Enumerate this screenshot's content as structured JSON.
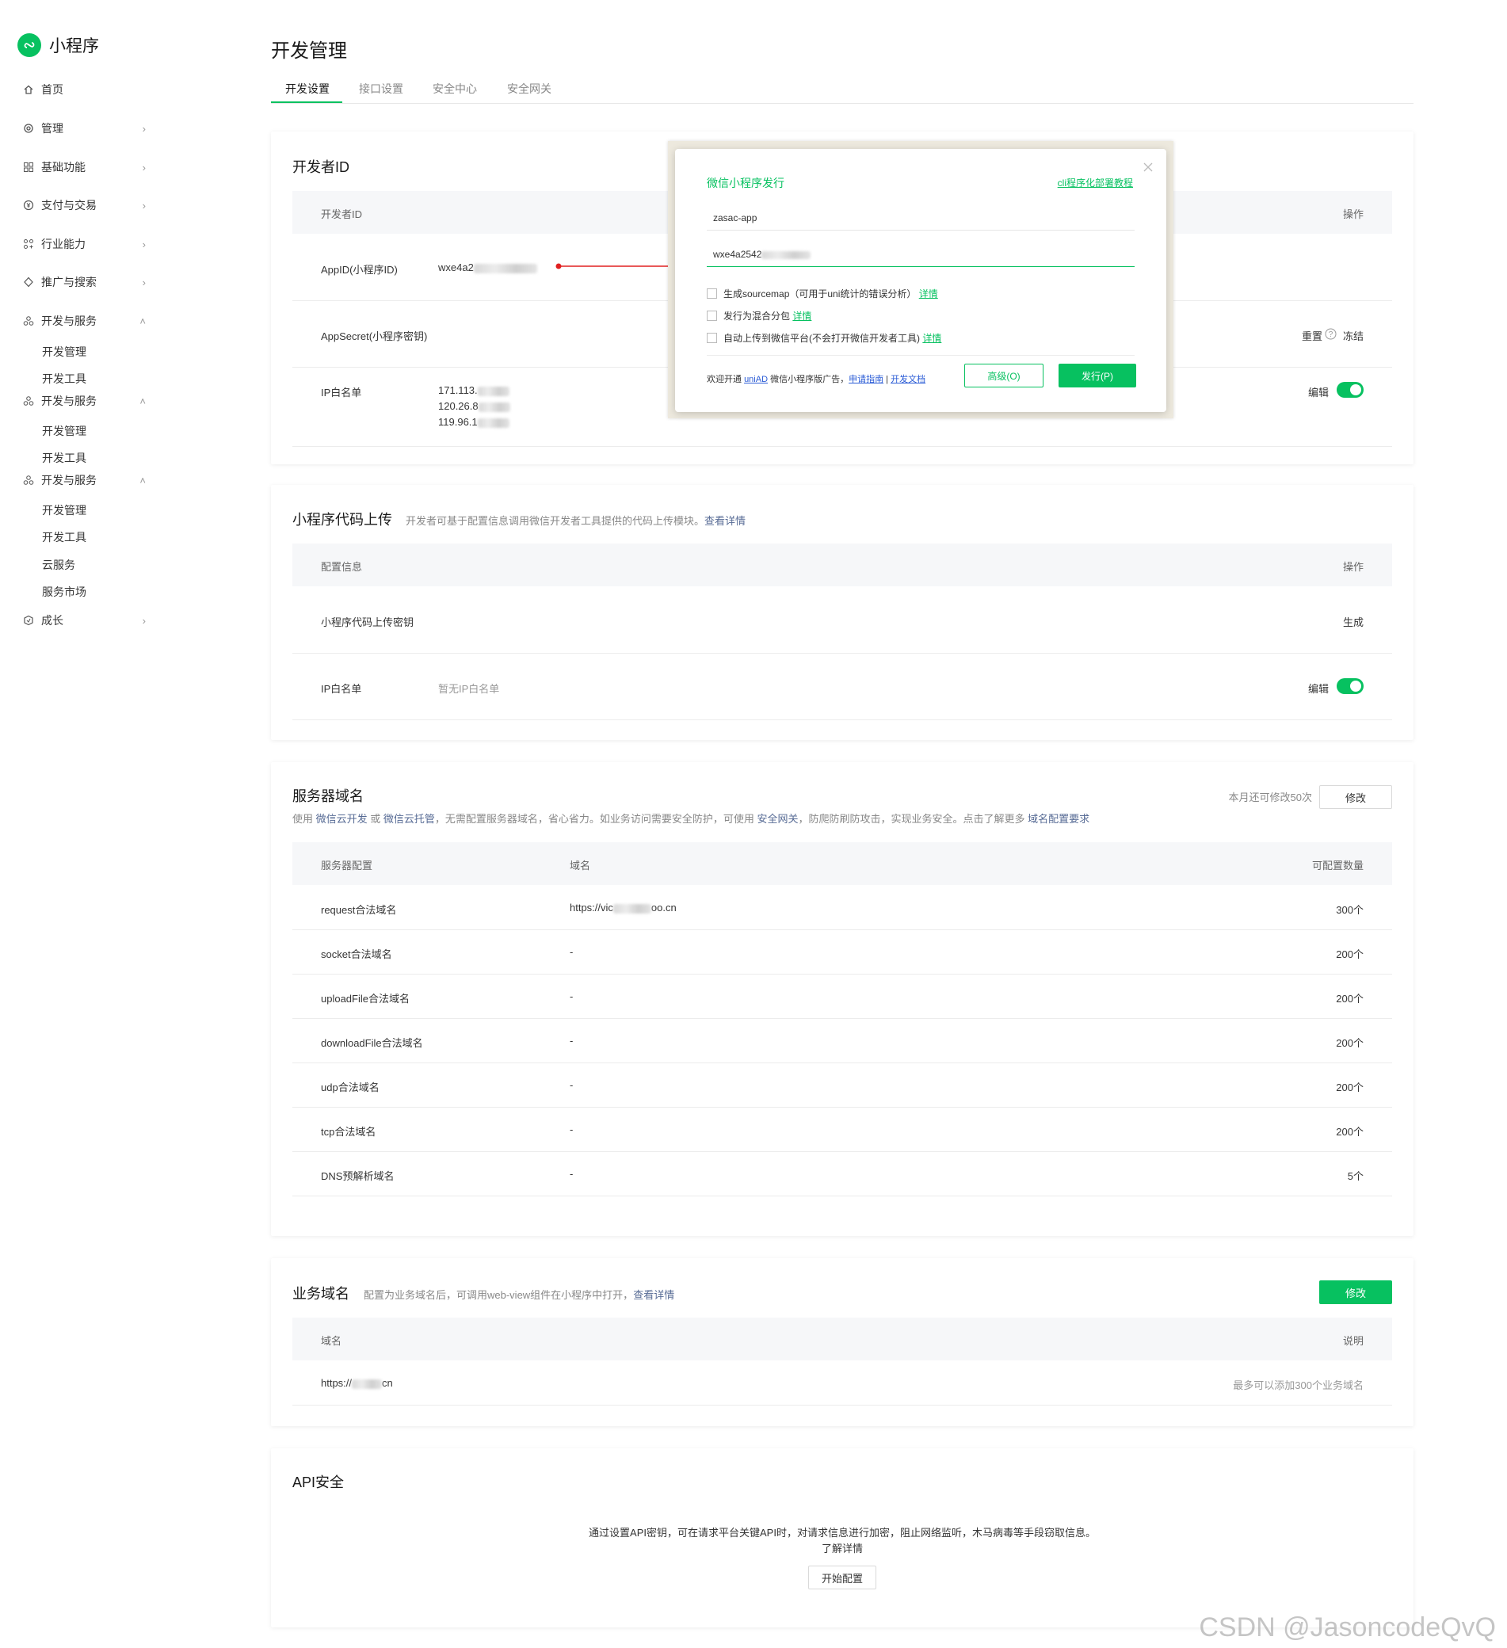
{
  "app": {
    "name": "小程序"
  },
  "sidebar": {
    "items": [
      {
        "label": "首页",
        "icon": "home-icon",
        "chevron": ""
      },
      {
        "label": "管理",
        "icon": "gear-icon",
        "chevron": "›"
      },
      {
        "label": "基础功能",
        "icon": "grid-icon",
        "chevron": "›"
      },
      {
        "label": "支付与交易",
        "icon": "yuan-icon",
        "chevron": "›"
      },
      {
        "label": "行业能力",
        "icon": "nodes-icon",
        "chevron": "›"
      },
      {
        "label": "推广与搜索",
        "icon": "tag-icon",
        "chevron": "›"
      },
      {
        "label": "开发与服务",
        "icon": "code-icon",
        "chevron": "˄"
      },
      {
        "label": "开发与服务",
        "icon": "code-icon",
        "chevron": "˄"
      },
      {
        "label": "开发与服务",
        "icon": "code-icon",
        "chevron": "˄"
      },
      {
        "label": "成长",
        "icon": "growth-icon",
        "chevron": "›"
      }
    ],
    "sub_a": [
      "开发管理",
      "开发工具"
    ],
    "sub_b": [
      "开发管理",
      "开发工具"
    ],
    "sub_c": [
      "开发管理",
      "开发工具",
      "云服务",
      "服务市场"
    ]
  },
  "header": {
    "title": "开发管理",
    "tabs": [
      "开发设置",
      "接口设置",
      "安全中心",
      "安全网关"
    ]
  },
  "developer_id": {
    "title": "开发者ID",
    "col_id": "开发者ID",
    "col_op": "操作",
    "appid_label": "AppID(小程序ID)",
    "appid_value": "wxe4a2",
    "secret_label": "AppSecret(小程序密钥)",
    "reset": "重置",
    "freeze": "冻结",
    "ip_label": "IP白名单",
    "ips": [
      "171.113.",
      "120.26.8",
      "119.96.1"
    ],
    "edit": "编辑"
  },
  "upload": {
    "title": "小程序代码上传",
    "desc": "开发者可基于配置信息调用微信开发者工具提供的代码上传模块。",
    "desc_link": "查看详情",
    "col_cfg": "配置信息",
    "col_op": "操作",
    "key_label": "小程序代码上传密钥",
    "generate": "生成",
    "ip_label": "IP白名单",
    "ip_value": "暂无IP白名单",
    "edit": "编辑"
  },
  "server_domain": {
    "title": "服务器域名",
    "quota_text": "本月还可修改50次",
    "modify": "修改",
    "desc_parts": [
      "使用 ",
      "微信云开发",
      " 或 ",
      "微信云托管",
      "，无需配置服务器域名，省心省力。如业务访问需要安全防护，可使用 ",
      "安全网关",
      "，防爬防刷防攻击，实现业务安全。点击了解更多 ",
      "域名配置要求"
    ],
    "columns": [
      "服务器配置",
      "域名",
      "可配置数量"
    ],
    "rows": [
      {
        "name": "request合法域名",
        "domain_prefix": "https://vic",
        "domain_suffix": "oo.cn",
        "count": "300个"
      },
      {
        "name": "socket合法域名",
        "domain_prefix": "-",
        "domain_suffix": "",
        "count": "200个"
      },
      {
        "name": "uploadFile合法域名",
        "domain_prefix": "-",
        "domain_suffix": "",
        "count": "200个"
      },
      {
        "name": "downloadFile合法域名",
        "domain_prefix": "-",
        "domain_suffix": "",
        "count": "200个"
      },
      {
        "name": "udp合法域名",
        "domain_prefix": "-",
        "domain_suffix": "",
        "count": "200个"
      },
      {
        "name": "tcp合法域名",
        "domain_prefix": "-",
        "domain_suffix": "",
        "count": "200个"
      },
      {
        "name": "DNS预解析域名",
        "domain_prefix": "-",
        "domain_suffix": "",
        "count": "5个"
      }
    ]
  },
  "biz_domain": {
    "title": "业务域名",
    "desc": "配置为业务域名后，可调用web-view组件在小程序中打开，",
    "desc_link": "查看详情",
    "modify": "修改",
    "col_domain": "域名",
    "col_note": "说明",
    "domain_prefix": "https://",
    "domain_suffix": "cn",
    "note": "最多可以添加300个业务域名"
  },
  "api_security": {
    "title": "API安全",
    "text": "通过设置API密钥，可在请求平台关键API时，对请求信息进行加密，阻止网络监听，木马病毒等手段窃取信息。",
    "link": "了解详情",
    "button": "开始配置"
  },
  "dialog": {
    "title": "微信小程序发行",
    "tutorial_link": "cli程序化部署教程",
    "name_value": "zasac-app",
    "appid_value": "wxe4a2542",
    "options": [
      {
        "label": "生成sourcemap（可用于uni统计的错误分析）",
        "link": "详情"
      },
      {
        "label": "发行为混合分包",
        "link": "详情"
      },
      {
        "label": "自动上传到微信平台(不会打开微信开发者工具)",
        "link": "详情"
      }
    ],
    "footer_prefix": "欢迎开通 ",
    "footer_uniad": "uniAD",
    "footer_mid": " 微信小程序版广告，",
    "footer_guide": "申请指南",
    "footer_sep": " | ",
    "footer_docs": "开发文档",
    "advanced": "高级(O)",
    "publish": "发行(P)"
  },
  "watermark": "CSDN @JasoncodeQvQ",
  "colors": {
    "accent": "#07c160",
    "link": "#576b95",
    "arrow": "#e02020"
  }
}
